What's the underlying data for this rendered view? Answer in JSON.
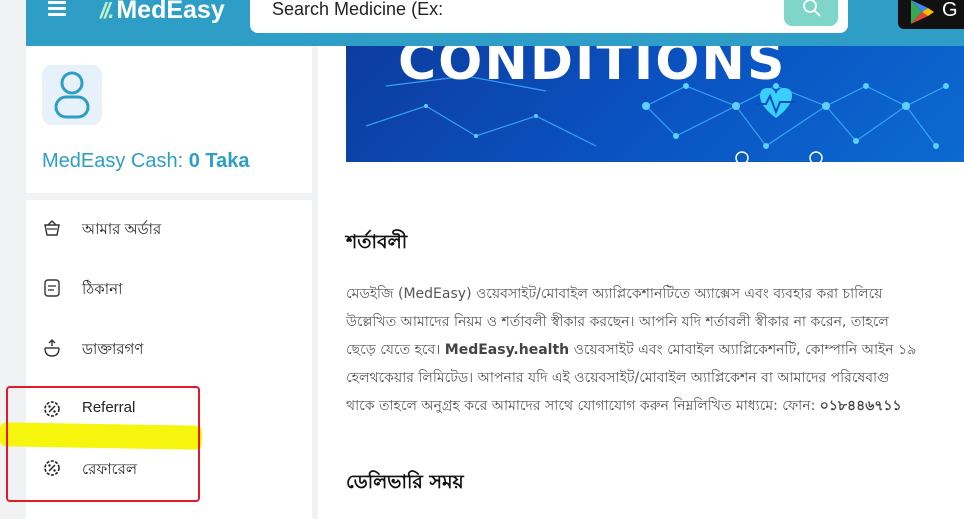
{
  "brand": {
    "logo_text": "MedEasy",
    "logo_mark": "//."
  },
  "search": {
    "placeholder": "Search Medicine (Ex:"
  },
  "play": {
    "text": "G"
  },
  "profile": {
    "cash_label": "MedEasy Cash:",
    "cash_value": "0 Taka"
  },
  "sidebar": {
    "items": [
      {
        "label": "আমার অর্ডার",
        "icon": "basket-icon"
      },
      {
        "label": "ঠিকানা",
        "icon": "address-icon"
      },
      {
        "label": "ডাক্তারগণ",
        "icon": "doctor-icon"
      },
      {
        "label": "Referral",
        "icon": "referral-icon"
      },
      {
        "label": "রেফারেল",
        "icon": "referral-icon"
      }
    ]
  },
  "banner": {
    "title": "CONDITIONS"
  },
  "main": {
    "section1_title": "শর্তাবলী",
    "para_lines": [
      "মেডইজি (MedEasy) ওয়েবসাইট/মোবাইল অ্যাপ্লিকেশানটিতে অ্যাক্সেস এবং ব্যবহার করা চালিয়ে",
      "উল্লেখিত আমাদের নিয়ম ও শর্তাবলী স্বীকার করছেন। আপনি যদি শর্তাবলী স্বীকার না করেন, তাহলে",
      "ছেড়ে যেতে হবে। ",
      "হেলথকেয়ার লিমিটেড। আপনার যদি এই ওয়েবসাইট/মোবাইল অ্যাপ্লিকেশন বা আমাদের পরিষেবাগু",
      "থাকে তাহলে অনুগ্রহ করে আমাদের সাথে যোগাযোগ করুন নিম্নলিখিত মাধ্যমে: ফোন: "
    ],
    "bold_site": "MedEasy.health",
    "line3_rest": " ওয়েবসাইট এবং মোবাইল অ্যাপ্লিকেশনটি, কোম্পানি আইন ১৯",
    "phone": "০১৮৪৪৬৭১১",
    "section2_title": "ডেলিভারি সময়"
  },
  "colors": {
    "accent": "#2f9ec6",
    "annotation_red": "#e01a2a",
    "annotation_yellow": "#f4f400"
  }
}
